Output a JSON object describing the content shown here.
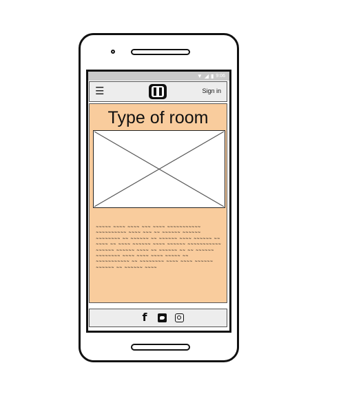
{
  "device": {
    "type": "android-phone-wireframe"
  },
  "status_bar": {
    "time": "9:06",
    "icons": [
      "wifi-icon",
      "signal-icon",
      "battery-icon"
    ]
  },
  "header": {
    "menu_icon": "hamburger-menu-icon",
    "logo_letter": "H",
    "signin_label": "Sign in"
  },
  "main": {
    "title": "Type of room",
    "image_placeholder": "image-placeholder-icon",
    "body_text": "~~~~~ ~~~~ ~~~~ ~~~ ~~~~ ~~~~~~~~~~~ ~~~~~~~~~~ ~~~~ ~~~ ~~ ~~~~~~ ~~~~~~ ~~~~~~~~ ~~ ~~~~~~ ~~ ~~~~~~ ~~~~ ~~~~~~ ~~ ~~~~ ~~ ~~~~ ~~~~~~ ~~~~ ~~~~~~ ~~~~~~~~~~~ ~~~~~~ ~~~~~~ ~~~~ ~~ ~~~~~~ ~~ ~~ ~~~~~~ ~~~~~~~~ ~~~~ ~~~~ ~~~~ ~~~~~ ~~ ~~~~~~~~~~~ ~~ ~~~~~~~~ ~~~~ ~~~~ ~~~~~~ ~~~~~~ ~~ ~~~~~~ ~~~~"
  },
  "footer": {
    "social_icons": [
      "facebook-icon",
      "twitter-icon",
      "instagram-icon"
    ]
  },
  "colors": {
    "content_background": "#f9cc9d",
    "header_background": "#ededed",
    "status_bar": "#c9c9c9"
  }
}
